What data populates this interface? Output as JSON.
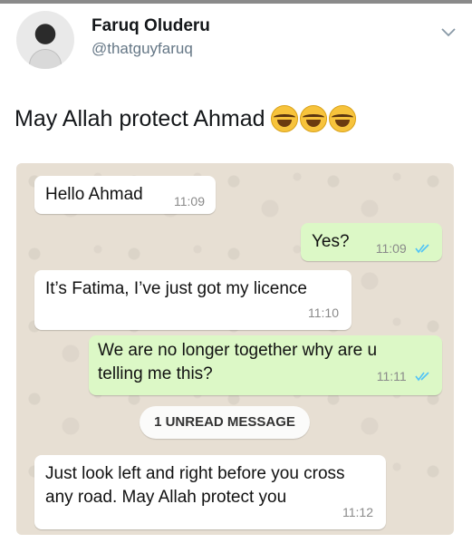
{
  "tweet": {
    "author_name": "Faruq Oluderu",
    "author_handle": "@thatguyfaruq",
    "text": "May Allah protect Ahmad",
    "emoji": [
      "face-with-tears-of-joy",
      "face-with-tears-of-joy",
      "face-with-tears-of-joy"
    ]
  },
  "chat": {
    "messages": [
      {
        "direction": "incoming",
        "text": "Hello Ahmad",
        "time": "11:09"
      },
      {
        "direction": "outgoing",
        "text": "Yes?",
        "time": "11:09",
        "status": "read"
      },
      {
        "direction": "incoming",
        "text": "It’s Fatima, I’ve just got my licence",
        "time": "11:10"
      },
      {
        "direction": "outgoing",
        "text": "We are no longer together why are u telling me this?",
        "time": "11:11",
        "status": "read"
      },
      {
        "direction": "incoming",
        "text": "Just look left and right before you cross any road. May Allah protect you",
        "time": "11:12"
      }
    ],
    "unread_label": "1 UNREAD MESSAGE"
  },
  "colors": {
    "incoming_bubble": "#ffffff",
    "outgoing_bubble": "#dcf8c6",
    "chat_background": "#e7dfd3",
    "read_ticks": "#4fc3f7",
    "handle_gray": "#657786"
  }
}
